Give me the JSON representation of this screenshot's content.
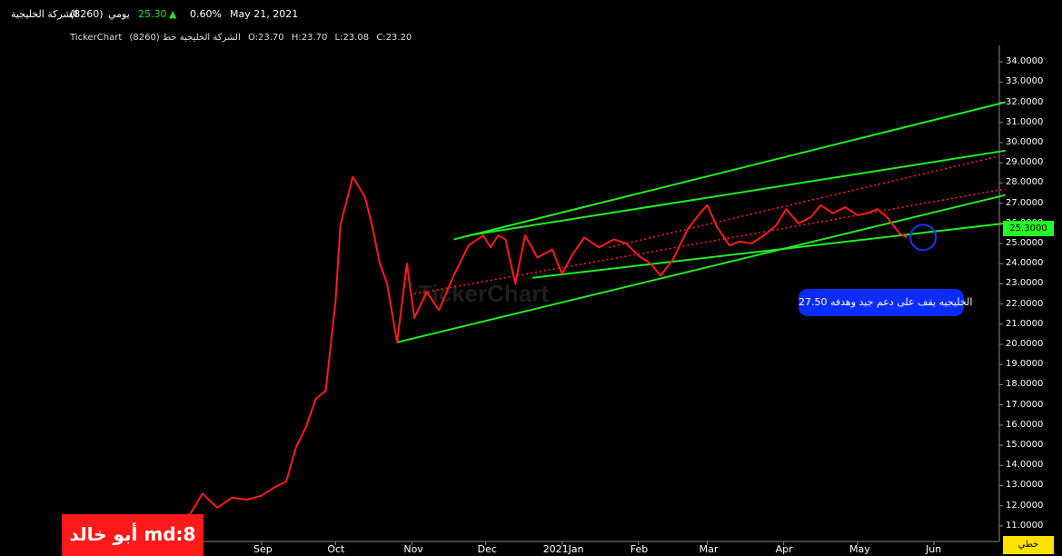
{
  "header": {
    "name": "الشركة الخليجية",
    "symbol": "(8260)",
    "period": "يومي",
    "price": "25.30",
    "change": "0.60%",
    "date": "May 21, 2021"
  },
  "subheader": {
    "source": "TickerChart",
    "series_label": "(8260) الشركة الخليجية خط",
    "open": "O:23.70",
    "high": "H:23.70",
    "low": "L:23.08",
    "close": "C:23.20"
  },
  "price_tag": "25.3000",
  "annotation": "الخليجيه يقف على دعم جيد وهدفه 27.50",
  "signature": "أبو خالد md:8",
  "scale_button": "خطي",
  "watermark": "TickerChart",
  "colors": {
    "background": "#000000",
    "price_line": "#ff1a1a",
    "trend_lines": "#22ee22",
    "mid_line": "#ff2020",
    "up": "#22dd22",
    "annotation_bg": "#0a2cff",
    "signature_bg": "#ff1a1a",
    "scale_bg": "#ffe200"
  },
  "chart_data": {
    "type": "line",
    "title": "",
    "xlabel": "",
    "ylabel": "",
    "x_ticks": [
      "Sep",
      "Oct",
      "Nov",
      "Dec",
      "2021Jan",
      "Feb",
      "Mar",
      "Apr",
      "May",
      "Jun"
    ],
    "y_ticks": [
      "34.0000",
      "33.0000",
      "32.0000",
      "31.0000",
      "30.0000",
      "29.0000",
      "28.0000",
      "27.0000",
      "26.0000",
      "25.0000",
      "24.0000",
      "23.0000",
      "22.0000",
      "21.0000",
      "20.0000",
      "19.0000",
      "18.0000",
      "17.0000",
      "16.0000",
      "15.0000",
      "14.0000",
      "13.0000",
      "12.0000",
      "11.0000"
    ],
    "ylim": [
      10.5,
      34.5
    ],
    "series": [
      {
        "values": [
          [
            "2020-07-20",
            10.9
          ],
          [
            "2020-07-27",
            11.2
          ],
          [
            "2020-08-03",
            11.6
          ],
          [
            "2020-08-08",
            12.6
          ],
          [
            "2020-08-14",
            11.9
          ],
          [
            "2020-08-20",
            12.4
          ],
          [
            "2020-08-26",
            12.3
          ],
          [
            "2020-09-01",
            12.5
          ],
          [
            "2020-09-06",
            12.9
          ],
          [
            "2020-09-11",
            13.2
          ],
          [
            "2020-09-15",
            14.9
          ],
          [
            "2020-09-19",
            15.9
          ],
          [
            "2020-09-23",
            17.3
          ],
          [
            "2020-09-27",
            17.7
          ],
          [
            "2020-10-01",
            22.1
          ],
          [
            "2020-10-03",
            25.9
          ],
          [
            "2020-10-08",
            28.3
          ],
          [
            "2020-10-13",
            27.3
          ],
          [
            "2020-10-16",
            25.8
          ],
          [
            "2020-10-19",
            24.0
          ],
          [
            "2020-10-22",
            23.0
          ],
          [
            "2020-10-26",
            20.1
          ],
          [
            "2020-10-30",
            24.0
          ],
          [
            "2020-11-02",
            21.3
          ],
          [
            "2020-11-07",
            22.6
          ],
          [
            "2020-11-12",
            21.7
          ],
          [
            "2020-11-18",
            23.4
          ],
          [
            "2020-11-24",
            24.9
          ],
          [
            "2020-11-30",
            25.4
          ],
          [
            "2020-12-03",
            24.8
          ],
          [
            "2020-12-06",
            25.4
          ],
          [
            "2020-12-09",
            25.2
          ],
          [
            "2020-12-13",
            23.0
          ],
          [
            "2020-12-17",
            25.4
          ],
          [
            "2020-12-22",
            24.3
          ],
          [
            "2020-12-28",
            24.7
          ],
          [
            "2021-01-01",
            23.5
          ],
          [
            "2021-01-05",
            24.4
          ],
          [
            "2021-01-10",
            25.3
          ],
          [
            "2021-01-16",
            24.8
          ],
          [
            "2021-01-22",
            25.2
          ],
          [
            "2021-01-27",
            25.0
          ],
          [
            "2021-02-01",
            24.4
          ],
          [
            "2021-02-06",
            24.0
          ],
          [
            "2021-02-10",
            23.4
          ],
          [
            "2021-02-15",
            24.2
          ],
          [
            "2021-02-21",
            25.7
          ],
          [
            "2021-02-26",
            26.5
          ],
          [
            "2021-03-01",
            26.9
          ],
          [
            "2021-03-05",
            25.8
          ],
          [
            "2021-03-10",
            24.9
          ],
          [
            "2021-03-14",
            25.1
          ],
          [
            "2021-03-19",
            25.0
          ],
          [
            "2021-03-24",
            25.4
          ],
          [
            "2021-03-29",
            25.9
          ],
          [
            "2021-04-02",
            26.7
          ],
          [
            "2021-04-07",
            26.0
          ],
          [
            "2021-04-12",
            26.3
          ],
          [
            "2021-04-16",
            26.9
          ],
          [
            "2021-04-21",
            26.5
          ],
          [
            "2021-04-26",
            26.8
          ],
          [
            "2021-05-01",
            26.4
          ],
          [
            "2021-05-05",
            26.5
          ],
          [
            "2021-05-09",
            26.7
          ],
          [
            "2021-05-13",
            26.3
          ],
          [
            "2021-05-18",
            25.5
          ],
          [
            "2021-05-21",
            25.3
          ]
        ]
      }
    ],
    "trend_lines": [
      {
        "style": "solid",
        "from": [
          "2020-10-26",
          20.1
        ],
        "to": [
          "2021-06-30",
          27.4
        ]
      },
      {
        "style": "solid",
        "from": [
          "2020-12-20",
          23.3
        ],
        "to": [
          "2021-06-30",
          26.0
        ]
      },
      {
        "style": "solid",
        "from": [
          "2020-11-18",
          25.2
        ],
        "to": [
          "2021-06-30",
          32.0
        ]
      },
      {
        "style": "solid",
        "from": [
          "2020-11-24",
          25.4
        ],
        "to": [
          "2021-06-30",
          29.6
        ]
      },
      {
        "style": "dotted",
        "from": [
          "2020-11-02",
          22.5
        ],
        "to": [
          "2021-06-30",
          27.7
        ]
      },
      {
        "style": "dotted",
        "from": [
          "2021-01-20",
          24.8
        ],
        "to": [
          "2021-06-30",
          29.4
        ]
      }
    ],
    "highlight_circle": [
      "2021-05-21",
      25.3
    ],
    "grid": false,
    "legend": "none"
  }
}
